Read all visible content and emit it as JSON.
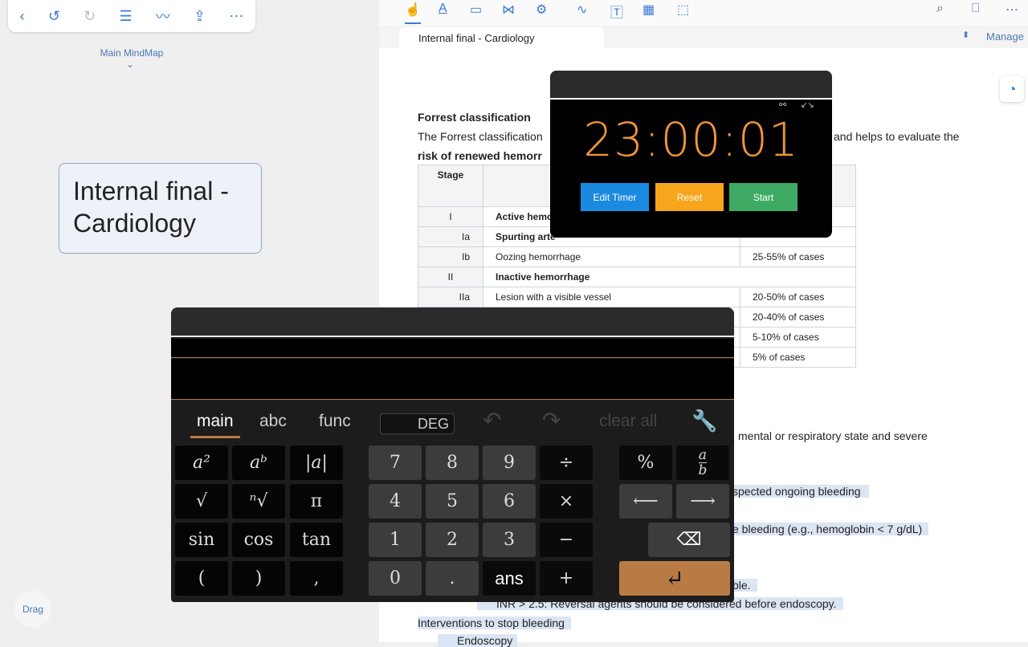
{
  "left_panel": {
    "toolbar_icons": [
      "back-icon",
      "undo-icon",
      "redo-icon",
      "list-icon",
      "pen-icon",
      "share-icon",
      "more-icon"
    ],
    "mindmap_label": "Main MindMap",
    "node_text": "Internal final - Cardiology",
    "drag_label": "Drag"
  },
  "doc_toolbar": {
    "icons": [
      "hand-icon",
      "text-highlight-icon",
      "rectangle-icon",
      "lasso-icon",
      "settings-icon",
      "scribble-icon",
      "textbox-icon",
      "image-icon",
      "select-icon",
      "search-icon",
      "bookmark-icon",
      "more-icon"
    ]
  },
  "tab": {
    "title": "Internal final - Cardiology",
    "manage": "Manage"
  },
  "doc": {
    "heading": "Forrest classification",
    "para_left": "The Forrest classification",
    "para_right": "and helps to evaluate the",
    "para_line2": "risk of renewed hemorr",
    "table": {
      "header": "Stage",
      "rows": [
        {
          "stage": "I",
          "desc": "Active hemo",
          "risk": ""
        },
        {
          "stage": "Ia",
          "desc": "Spurting arte",
          "risk": ""
        },
        {
          "stage": "Ib",
          "desc": "Oozing hemorrhage",
          "risk": "25-55% of cases"
        },
        {
          "stage": "II",
          "desc": "Inactive hemorrhage",
          "risk": ""
        },
        {
          "stage": "IIa",
          "desc": "Lesion with a visible vessel",
          "risk": "20-50% of cases"
        },
        {
          "stage": "",
          "desc": "",
          "risk": "20-40% of cases"
        },
        {
          "stage": "",
          "desc": "",
          "risk": "5-10% of cases"
        },
        {
          "stage": "",
          "desc": "",
          "risk": "5% of cases"
        }
      ]
    },
    "line1": "mental or respiratory state and severe",
    "line2": "spected ongoing bleeding",
    "line3": "e bleeding (e.g., hemoglobin < 7 g/dL)",
    "line4": "ble.",
    "line5": "INR > 2.5: Reversal agents should be considered before endoscopy.",
    "line6": "Interventions to stop bleeding",
    "line7": "Endoscopy"
  },
  "timer": {
    "time": "23:00:01",
    "edit": "Edit Timer",
    "reset": "Reset",
    "start": "Start",
    "colors": {
      "time": "#f0963a",
      "edit": "#1a8ae0",
      "reset": "#f7a51c",
      "start": "#3faa63"
    }
  },
  "calculator": {
    "tabs": [
      "main",
      "abc",
      "func"
    ],
    "active_tab": "main",
    "angle_mode": "DEG",
    "clear": "clear all",
    "keys": {
      "sq": "a²",
      "pow": "aᵇ",
      "abs": "|a|",
      "sqrt": "√",
      "nroot": "ⁿ√",
      "pi": "π",
      "sin": "sin",
      "cos": "cos",
      "tan": "tan",
      "lp": "(",
      "rp": ")",
      "comma": ",",
      "n7": "7",
      "n8": "8",
      "n9": "9",
      "div": "÷",
      "n4": "4",
      "n5": "5",
      "n6": "6",
      "mul": "×",
      "n1": "1",
      "n2": "2",
      "n3": "3",
      "sub": "−",
      "n0": "0",
      "dot": ".",
      "ans": "ans",
      "add": "+",
      "pct": "%",
      "frac_a": "a",
      "frac_b": "b",
      "left": "⟵",
      "right": "⟶",
      "bksp": "⌫",
      "enter": "↵"
    },
    "enter_color": "#b97b44"
  }
}
